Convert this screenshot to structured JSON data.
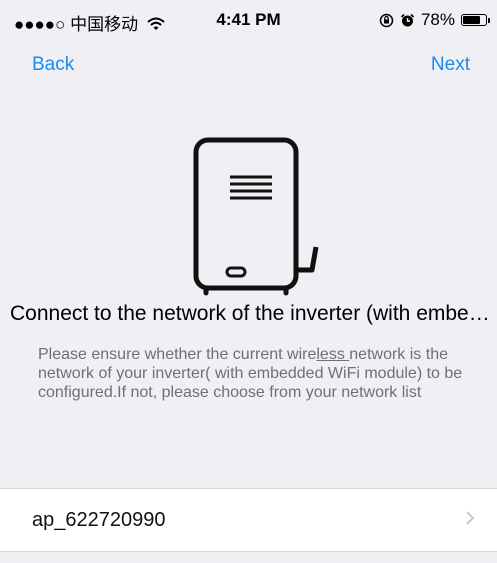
{
  "status_bar": {
    "carrier": "●●●●○ 中国移动",
    "time": "4:41 PM",
    "battery_text": "78%",
    "battery_level": 0.78
  },
  "nav": {
    "back_label": "Back",
    "next_label": "Next",
    "accent_color": "#1a8cf0"
  },
  "main": {
    "title": "Connect to the network of the inverter (with embedded WiFi module)",
    "description_part1": "Please ensure whether the current wire",
    "description_underlined": "less ",
    "description_part2": "network is the network of your inverter( with embedded WiFi module) to be configured.If not, please choose from your network list"
  },
  "network": {
    "ssid": "ap_622720990"
  },
  "icons": [
    "wifi-icon",
    "rotation-lock-icon",
    "alarm-icon",
    "battery-icon",
    "inverter-device-icon",
    "chevron-right-icon"
  ]
}
